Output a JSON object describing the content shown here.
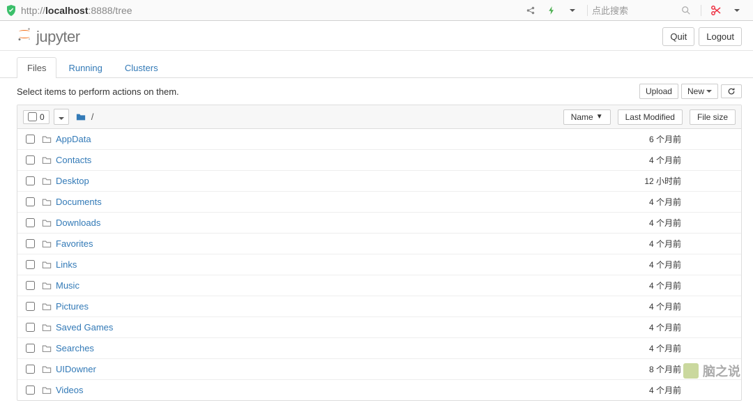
{
  "browser": {
    "url_scheme": "http://",
    "url_host": "localhost",
    "url_port_path": ":8888/tree",
    "search_placeholder": "点此搜索"
  },
  "header": {
    "logo_text": "jupyter",
    "quit": "Quit",
    "logout": "Logout"
  },
  "tabs": [
    {
      "label": "Files",
      "active": true
    },
    {
      "label": "Running",
      "active": false
    },
    {
      "label": "Clusters",
      "active": false
    }
  ],
  "toolbar": {
    "hint": "Select items to perform actions on them.",
    "upload": "Upload",
    "new": "New"
  },
  "list_header": {
    "selected_count": "0",
    "breadcrumb_sep": "/",
    "col_name": "Name",
    "col_modified": "Last Modified",
    "col_size": "File size"
  },
  "rows": [
    {
      "name": "AppData",
      "modified": "6 个月前",
      "size": ""
    },
    {
      "name": "Contacts",
      "modified": "4 个月前",
      "size": ""
    },
    {
      "name": "Desktop",
      "modified": "12 小时前",
      "size": ""
    },
    {
      "name": "Documents",
      "modified": "4 个月前",
      "size": ""
    },
    {
      "name": "Downloads",
      "modified": "4 个月前",
      "size": ""
    },
    {
      "name": "Favorites",
      "modified": "4 个月前",
      "size": ""
    },
    {
      "name": "Links",
      "modified": "4 个月前",
      "size": ""
    },
    {
      "name": "Music",
      "modified": "4 个月前",
      "size": ""
    },
    {
      "name": "Pictures",
      "modified": "4 个月前",
      "size": ""
    },
    {
      "name": "Saved Games",
      "modified": "4 个月前",
      "size": ""
    },
    {
      "name": "Searches",
      "modified": "4 个月前",
      "size": ""
    },
    {
      "name": "UIDowner",
      "modified": "8 个月前",
      "size": ""
    },
    {
      "name": "Videos",
      "modified": "4 个月前",
      "size": ""
    }
  ],
  "watermark": {
    "text": "脑之说"
  }
}
